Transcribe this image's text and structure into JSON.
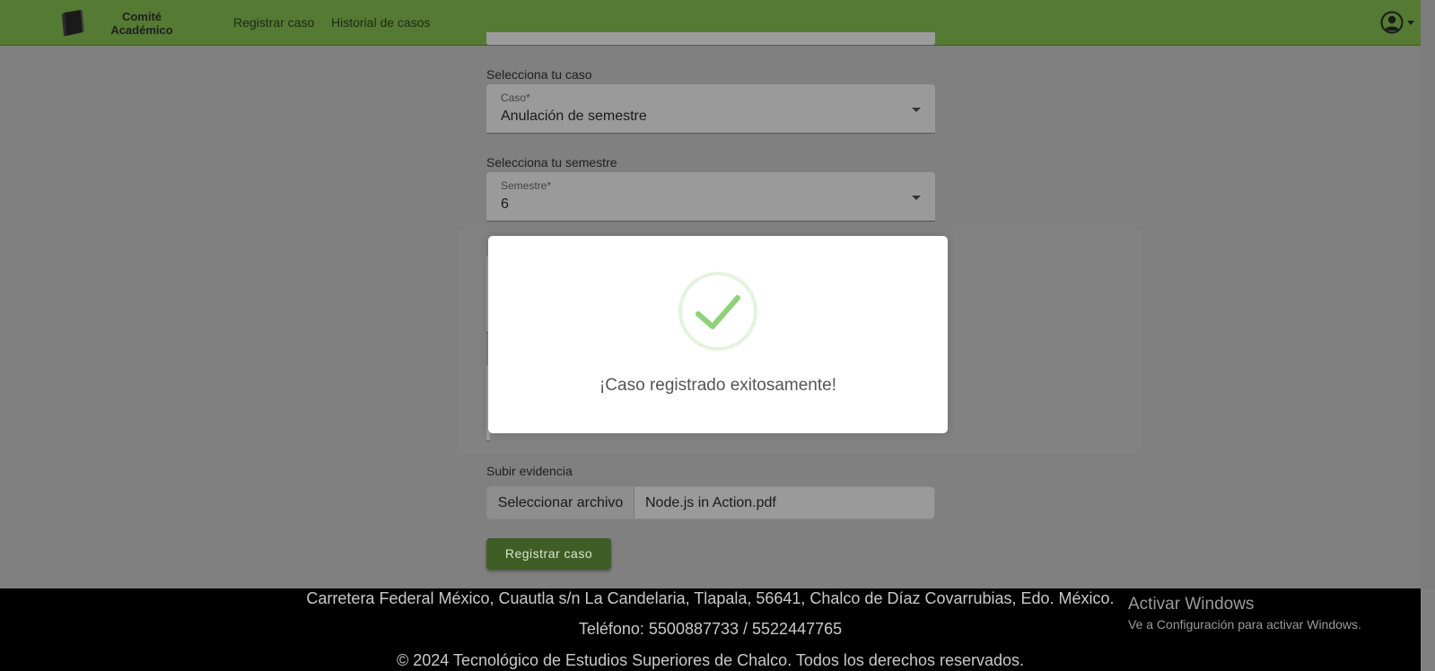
{
  "navbar": {
    "brand_line1": "Comité",
    "brand_line2": "Académico",
    "links": [
      "Registrar caso",
      "Historial de casos"
    ]
  },
  "form": {
    "case": {
      "label": "Selecciona tu caso",
      "field_label": "Caso*",
      "value": "Anulación de semestre"
    },
    "semester": {
      "label": "Selecciona tu semestre",
      "field_label": "Semestre*",
      "value": "6"
    },
    "evidence": {
      "label": "Subir evidencia",
      "button_label": "Seleccionar archivo",
      "file_name": "Node.js in Action.pdf"
    },
    "submit_label": "Registrar caso"
  },
  "modal": {
    "icon": "check-circle-icon",
    "message": "¡Caso registrado exitosamente!"
  },
  "footer": {
    "address": "Carretera Federal México, Cuautla s/n La Candelaria, Tlapala, 56641, Chalco de Díaz Covarrubias, Edo. México.",
    "phone": "Teléfono: 5500887733 / 5522447765",
    "copyright": "© 2024 Tecnológico de Estudios Superiores de Chalco. Todos los derechos reservados."
  },
  "windows_watermark": {
    "title": "Activar Windows",
    "subtitle": "Ve a Configuración para activar Windows."
  },
  "colors": {
    "navbar": "#547a33",
    "accent_button": "#3f5e25",
    "success": "#8fd17a"
  }
}
